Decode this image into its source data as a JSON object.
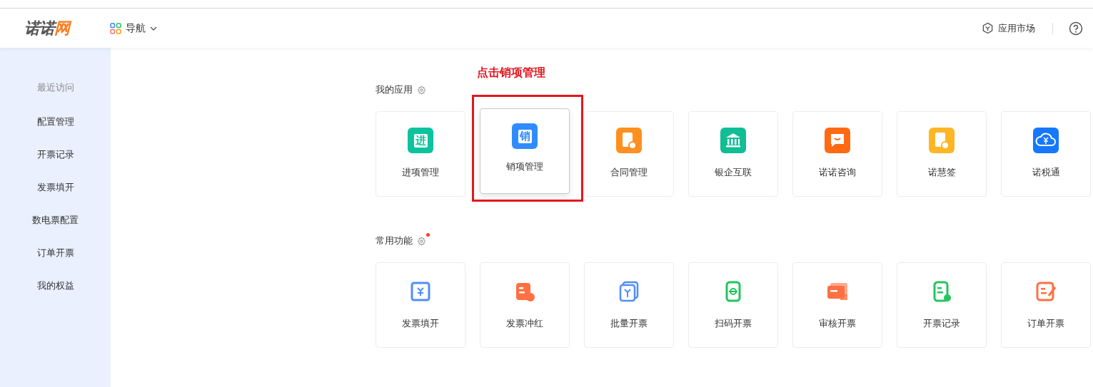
{
  "header": {
    "logo": {
      "part_1": "诺诺",
      "part_2": "网"
    },
    "nav": {
      "label": "导航"
    },
    "market": {
      "label": "应用市场"
    }
  },
  "sidebar": {
    "title": "最近访问",
    "items": [
      {
        "label": "配置管理"
      },
      {
        "label": "开票记录"
      },
      {
        "label": "发票填开"
      },
      {
        "label": "数电票配置"
      },
      {
        "label": "订单开票"
      },
      {
        "label": "我的权益"
      }
    ]
  },
  "sections": [
    {
      "title": "我的应用",
      "notice_dot": false,
      "cards": [
        {
          "label": "进项管理",
          "glyph": "进",
          "color": "#0dc39e",
          "selected": false
        },
        {
          "label": "销项管理",
          "glyph": "销",
          "color": "#2f8cff",
          "selected": true
        },
        {
          "label": "合同管理",
          "color": "#ff8f1f",
          "selected": false
        },
        {
          "label": "银企互联",
          "color": "#10bd94",
          "selected": false
        },
        {
          "label": "诺诺咨询",
          "color": "#ff6a13",
          "selected": false
        },
        {
          "label": "诺慧签",
          "color": "#ffb624",
          "selected": false
        },
        {
          "label": "诺税通",
          "color": "#1677ff",
          "selected": false
        }
      ]
    },
    {
      "title": "常用功能",
      "notice_dot": true,
      "cards": [
        {
          "label": "发票填开",
          "color": "#4f8dff",
          "selected": false
        },
        {
          "label": "发票冲红",
          "color": "#ff7043",
          "selected": false
        },
        {
          "label": "批量开票",
          "color": "#4f8dff",
          "selected": false
        },
        {
          "label": "扫码开票",
          "color": "#22c55e",
          "selected": false
        },
        {
          "label": "审核开票",
          "color": "#ff7043",
          "selected": false
        },
        {
          "label": "开票记录",
          "color": "#22c55e",
          "selected": false
        },
        {
          "label": "订单开票",
          "color": "#ff7043",
          "selected": false
        }
      ]
    }
  ],
  "annotation": {
    "text": "点击销项管理"
  }
}
